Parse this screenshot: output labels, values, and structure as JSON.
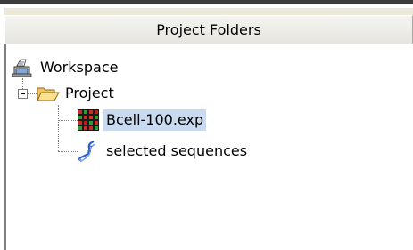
{
  "panel": {
    "title": "Project Folders"
  },
  "tree": {
    "workspace": {
      "label": "Workspace",
      "icon": "workspace-icon"
    },
    "project": {
      "label": "Project",
      "icon": "folder-open-icon",
      "expanded": true
    },
    "items": [
      {
        "label": "Bcell-100.exp",
        "icon": "microarray-icon",
        "selected": true
      },
      {
        "label": "selected sequences",
        "icon": "dna-sequence-icon",
        "selected": false
      }
    ]
  },
  "colors": {
    "selection": "#c9d9ee",
    "header_bg": "#ece9d8",
    "folder": "#f5c542"
  }
}
